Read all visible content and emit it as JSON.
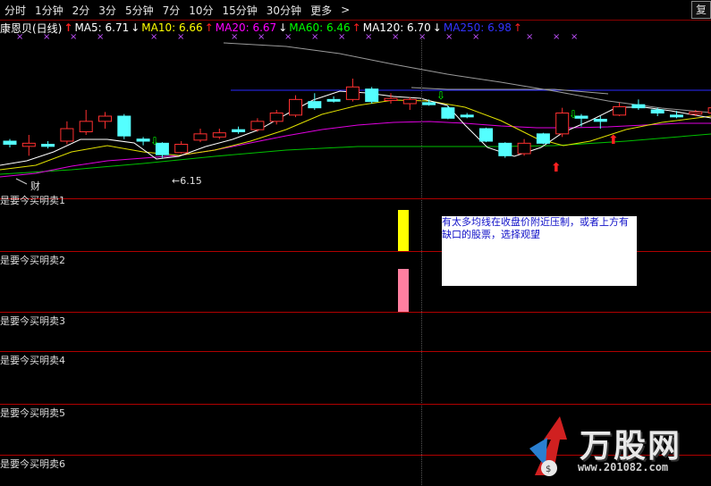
{
  "toolbar": {
    "items": [
      "分时",
      "1分钟",
      "2分",
      "3分",
      "5分钟",
      "7分",
      "10分",
      "15分钟",
      "30分钟",
      "更多",
      ">"
    ],
    "restore": "复"
  },
  "ma_bar": {
    "stock_name": "康恩贝(日线)",
    "ma5": "MA5: 6.71",
    "ma10": "MA10: 6.66",
    "ma20": "MA20: 6.67",
    "ma60": "MA60: 6.46",
    "ma120": "MA120: 6.70",
    "ma250": "MA250: 6.98",
    "colors": {
      "ma5": "#ffffff",
      "ma10": "#ffff00",
      "ma20": "#ff00ff",
      "ma60": "#00ff00",
      "ma120": "#ffffff",
      "ma250": "#3333ff",
      "up_arrow": "#ff2020",
      "down_arrow": "#ffffff"
    }
  },
  "chart_labels": {
    "low_price": "←6.15",
    "cai": "财"
  },
  "panels": [
    {
      "label": "是要今买明卖1"
    },
    {
      "label": "是要今买明卖2"
    },
    {
      "label": "是要今买明卖3"
    },
    {
      "label": "是要今买明卖4"
    },
    {
      "label": "是要今买明卖5"
    },
    {
      "label": "是要今买明卖6"
    }
  ],
  "note": {
    "text": "有太多均线在收盘价附近压制，或者上方有缺口的股票，选择观望"
  },
  "logo": {
    "text": "万股网",
    "url": "www.201082.com"
  },
  "chart_data": {
    "type": "candlestick",
    "price_range": [
      6.0,
      7.2
    ],
    "low_marker": 6.15,
    "candles": [
      {
        "o": 6.33,
        "c": 6.36,
        "h": 6.38,
        "l": 6.3,
        "up": false
      },
      {
        "o": 6.31,
        "c": 6.34,
        "h": 6.42,
        "l": 6.22,
        "up": true
      },
      {
        "o": 6.31,
        "c": 6.33,
        "h": 6.36,
        "l": 6.29,
        "up": false
      },
      {
        "o": 6.36,
        "c": 6.48,
        "h": 6.55,
        "l": 6.33,
        "up": true
      },
      {
        "o": 6.45,
        "c": 6.55,
        "h": 6.66,
        "l": 6.42,
        "up": true
      },
      {
        "o": 6.55,
        "c": 6.6,
        "h": 6.64,
        "l": 6.48,
        "up": true
      },
      {
        "o": 6.6,
        "c": 6.41,
        "h": 6.62,
        "l": 6.38,
        "up": false
      },
      {
        "o": 6.38,
        "c": 6.36,
        "h": 6.4,
        "l": 6.32,
        "up": false
      },
      {
        "o": 6.34,
        "c": 6.23,
        "h": 6.35,
        "l": 6.2,
        "up": false
      },
      {
        "o": 6.25,
        "c": 6.33,
        "h": 6.36,
        "l": 6.24,
        "up": true
      },
      {
        "o": 6.37,
        "c": 6.43,
        "h": 6.48,
        "l": 6.35,
        "up": true
      },
      {
        "o": 6.4,
        "c": 6.44,
        "h": 6.48,
        "l": 6.38,
        "up": true
      },
      {
        "o": 6.45,
        "c": 6.47,
        "h": 6.5,
        "l": 6.43,
        "up": false
      },
      {
        "o": 6.47,
        "c": 6.55,
        "h": 6.58,
        "l": 6.45,
        "up": true
      },
      {
        "o": 6.55,
        "c": 6.63,
        "h": 6.66,
        "l": 6.52,
        "up": true
      },
      {
        "o": 6.61,
        "c": 6.76,
        "h": 6.8,
        "l": 6.59,
        "up": true
      },
      {
        "o": 6.74,
        "c": 6.68,
        "h": 6.82,
        "l": 6.66,
        "up": false
      },
      {
        "o": 6.75,
        "c": 6.76,
        "h": 6.79,
        "l": 6.73,
        "up": false
      },
      {
        "o": 6.76,
        "c": 6.88,
        "h": 6.96,
        "l": 6.74,
        "up": true
      },
      {
        "o": 6.86,
        "c": 6.74,
        "h": 6.88,
        "l": 6.72,
        "up": false
      },
      {
        "o": 6.75,
        "c": 6.77,
        "h": 6.82,
        "l": 6.72,
        "up": true
      },
      {
        "o": 6.76,
        "c": 6.72,
        "h": 6.78,
        "l": 6.66,
        "up": true
      },
      {
        "o": 6.73,
        "c": 6.71,
        "h": 6.76,
        "l": 6.7,
        "up": false
      },
      {
        "o": 6.68,
        "c": 6.58,
        "h": 6.7,
        "l": 6.57,
        "up": false
      },
      {
        "o": 6.61,
        "c": 6.6,
        "h": 6.63,
        "l": 6.58,
        "up": false
      },
      {
        "o": 6.48,
        "c": 6.36,
        "h": 6.49,
        "l": 6.35,
        "up": false
      },
      {
        "o": 6.34,
        "c": 6.22,
        "h": 6.35,
        "l": 6.2,
        "up": false
      },
      {
        "o": 6.24,
        "c": 6.34,
        "h": 6.38,
        "l": 6.22,
        "up": true
      },
      {
        "o": 6.43,
        "c": 6.34,
        "h": 6.44,
        "l": 6.33,
        "up": false
      },
      {
        "o": 6.43,
        "c": 6.63,
        "h": 6.68,
        "l": 6.4,
        "up": true
      },
      {
        "o": 6.6,
        "c": 6.58,
        "h": 6.62,
        "l": 6.5,
        "up": false
      },
      {
        "o": 6.57,
        "c": 6.55,
        "h": 6.6,
        "l": 6.48,
        "up": false
      },
      {
        "o": 6.61,
        "c": 6.69,
        "h": 6.73,
        "l": 6.6,
        "up": true
      },
      {
        "o": 6.71,
        "c": 6.68,
        "h": 6.76,
        "l": 6.66,
        "up": false
      },
      {
        "o": 6.66,
        "c": 6.63,
        "h": 6.68,
        "l": 6.6,
        "up": false
      },
      {
        "o": 6.61,
        "c": 6.61,
        "h": 6.65,
        "l": 6.58,
        "up": false
      },
      {
        "o": 6.62,
        "c": 6.64,
        "h": 6.66,
        "l": 6.6,
        "up": true
      },
      {
        "o": 6.63,
        "c": 6.68,
        "h": 6.73,
        "l": 6.61,
        "up": true
      }
    ]
  }
}
